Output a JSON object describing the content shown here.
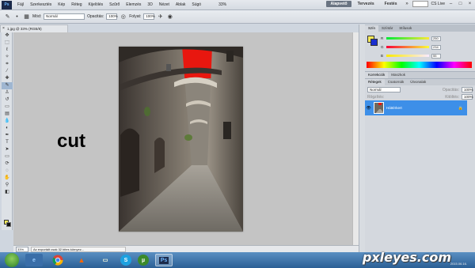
{
  "app": {
    "logo": "Ps",
    "menu": [
      "Fájl",
      "Szerkesztés",
      "Kép",
      "Réteg",
      "Kijelölés",
      "Szűrő",
      "Elemzés",
      "3D",
      "Nézet",
      "Ablak",
      "Súgó"
    ],
    "zoom_display": "33%",
    "workspaces": [
      "Alapvető",
      "Tervezés",
      "Festés"
    ],
    "cslive": "CS Live"
  },
  "options": {
    "mode_label": "Mód:",
    "mode_value": "Normál",
    "opacity_label": "Opacitás:",
    "opacity_value": "100%",
    "flow_label": "Folyat:",
    "flow_value": "100%"
  },
  "document": {
    "tab_label": "1.jpg @ 33% (RGB/8)",
    "cut_text": "cut",
    "zoom_status": "33%",
    "status_text": "Az exportált csak 32 bites környez..."
  },
  "color_panel": {
    "tabs": [
      "Szín",
      "Színtár",
      "Stílusok"
    ],
    "r_label": "R",
    "g_label": "G",
    "b_label": "B",
    "r_value": "250",
    "g_value": "234",
    "b_value": "55"
  },
  "layers_panel": {
    "top_tabs": [
      "Korrekciók",
      "Maszkok"
    ],
    "tabs": [
      "Rétegek",
      "Csatornák",
      "Útvonalak"
    ],
    "blend_mode": "Normál",
    "opacity_label": "Opacitás:",
    "opacity_value": "100%",
    "lock_label": "Rögzítés:",
    "fill_label": "Kitöltés:",
    "fill_value": "100%",
    "layer_name": "Háttérkert"
  },
  "taskbar": {
    "ps_label": "Ps",
    "time": "",
    "date": ""
  },
  "watermark": {
    "text": "pxleyes.com",
    "date": "2015.06.16."
  },
  "colors": {
    "foreground": "#f4e85a",
    "background": "#1a2fd0",
    "layer_selected": "#3d8fe8"
  }
}
